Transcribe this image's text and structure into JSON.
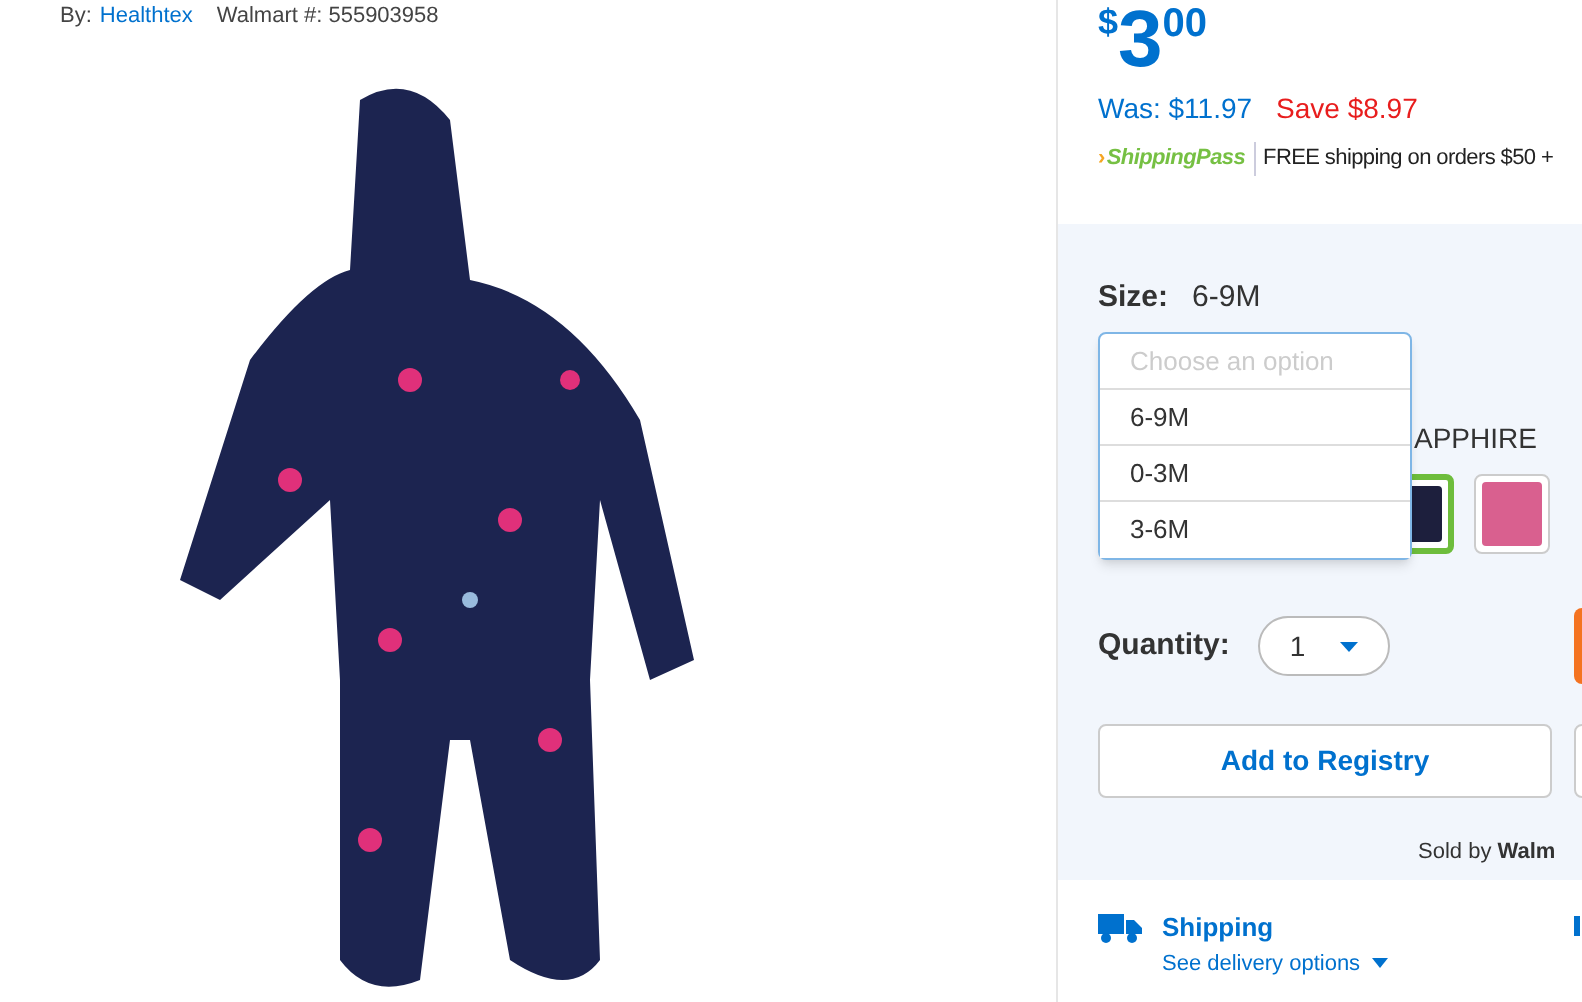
{
  "byline": {
    "brand_label": "By:",
    "brand": "Healthtex",
    "item_number": "Walmart #: 555903958"
  },
  "price": {
    "currency": "$",
    "whole": "3",
    "cents": "00",
    "was": "Was: $11.97",
    "save": "Save $8.97"
  },
  "shipping_pass": {
    "logo_mark": "›",
    "logo_word1": "Shipping",
    "logo_word2": "Pass",
    "text": "FREE shipping on orders $50 +"
  },
  "size": {
    "label": "Size:",
    "value": "6-9M",
    "dropdown": {
      "placeholder": "Choose an option",
      "options": [
        {
          "label": "6-9M",
          "selected": false
        },
        {
          "label": "0-3M",
          "selected": false
        },
        {
          "label": "3-6M",
          "selected": false
        }
      ]
    }
  },
  "color": {
    "value": "APPHIRE",
    "swatches": [
      {
        "kind": "navy",
        "selected": true
      },
      {
        "kind": "pink",
        "selected": false
      }
    ]
  },
  "quantity": {
    "label": "Quantity:",
    "value": "1"
  },
  "add_to_registry": "Add to Registry",
  "sold_by": {
    "label": "Sold by",
    "seller": "Walm"
  },
  "shipping": {
    "title": "Shipping",
    "link": "See delivery options"
  }
}
